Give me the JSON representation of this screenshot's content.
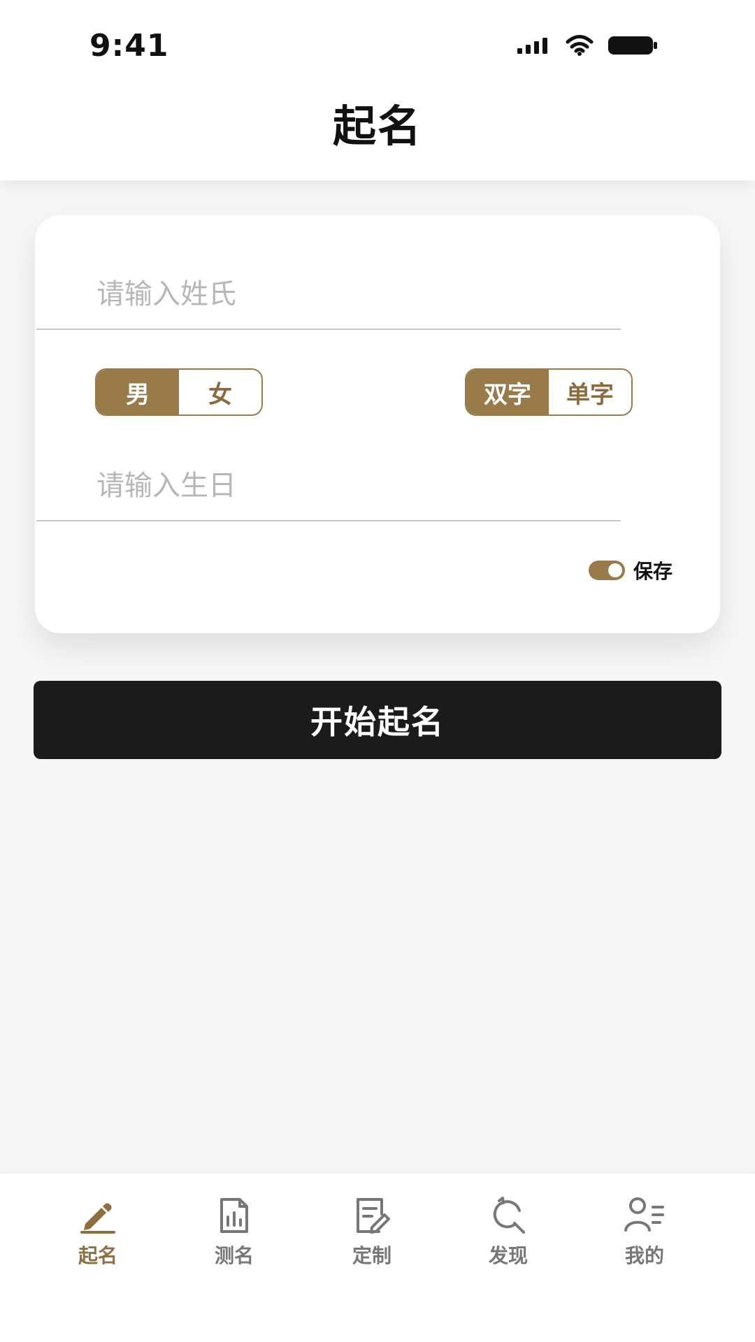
{
  "status": {
    "time": "9:41"
  },
  "header": {
    "title": "起名"
  },
  "form": {
    "surname_placeholder": "请输入姓氏",
    "birthday_placeholder": "请输入生日",
    "gender_options": [
      "男",
      "女"
    ],
    "word_count_options": [
      "双字",
      "单字"
    ],
    "save_label": "保存"
  },
  "actions": {
    "start_label": "开始起名"
  },
  "tabs": [
    {
      "label": "起名",
      "icon": "pen-icon"
    },
    {
      "label": "测名",
      "icon": "chart-document-icon"
    },
    {
      "label": "定制",
      "icon": "edit-document-icon"
    },
    {
      "label": "发现",
      "icon": "discover-icon"
    },
    {
      "label": "我的",
      "icon": "profile-icon"
    }
  ],
  "colors": {
    "accent": "#997b4a",
    "accent_dark": "#8e6f3f",
    "button_dark": "#1b1b1b",
    "background": "#f7f7f7",
    "tab_inactive": "#777777"
  }
}
